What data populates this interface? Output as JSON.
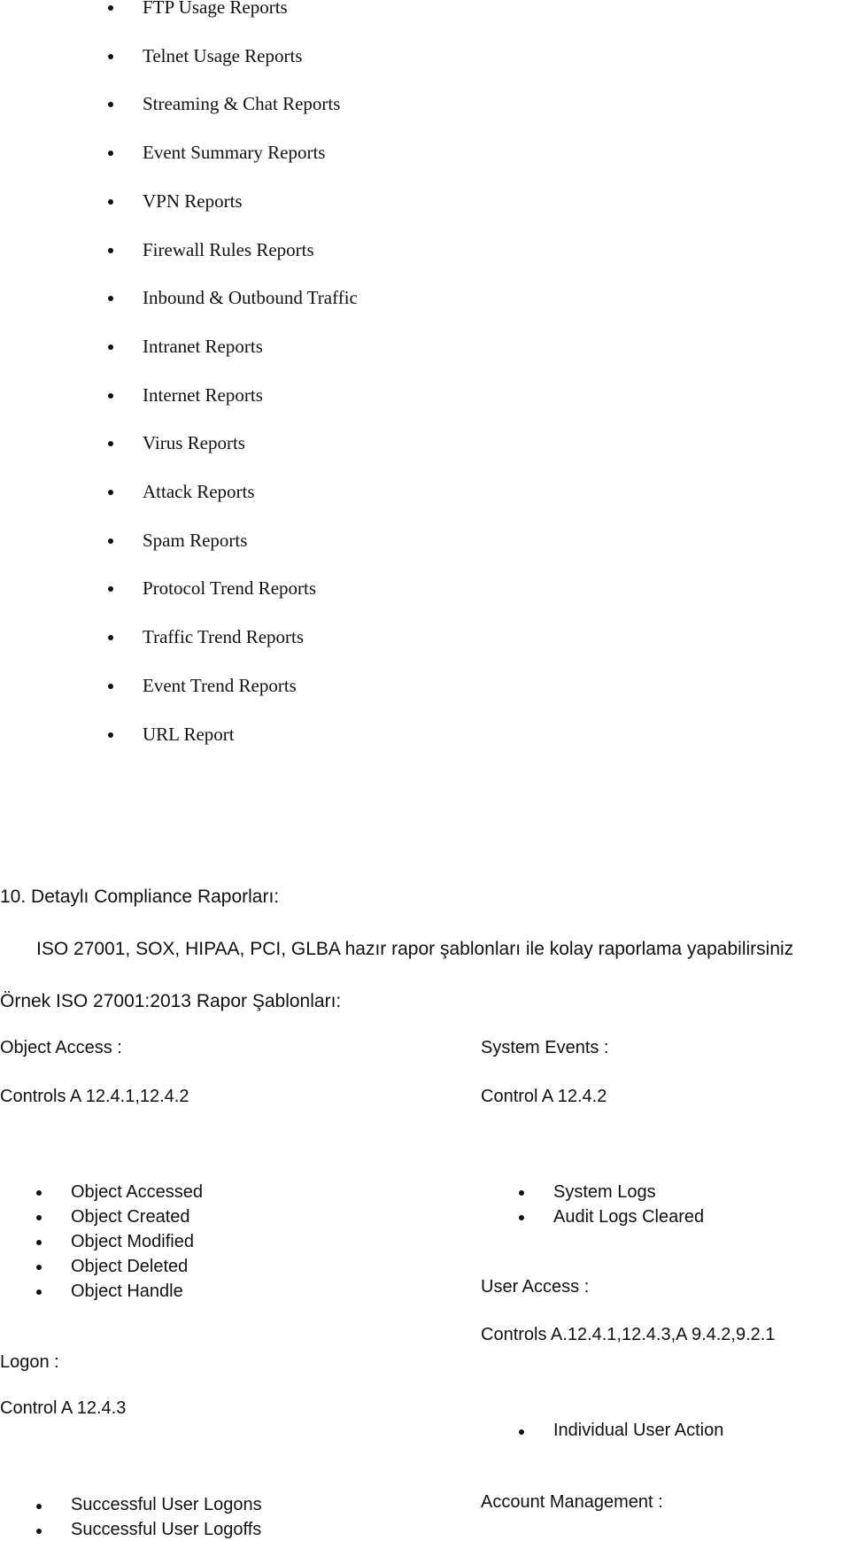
{
  "report_list": [
    "FTP Usage Reports",
    "Telnet Usage Reports",
    "Streaming & Chat Reports",
    "Event Summary Reports",
    "VPN Reports",
    "Firewall Rules Reports",
    "Inbound & Outbound Traffic",
    "Intranet Reports",
    "Internet Reports",
    "Virus Reports",
    "Attack Reports",
    "Spam Reports",
    "Protocol Trend Reports",
    "Traffic Trend Reports",
    "Event Trend Reports",
    "URL Report"
  ],
  "section": {
    "heading": "10. Detaylı Compliance Raporları:",
    "intro": "ISO 27001, SOX, HIPAA, PCI, GLBA hazır rapor şablonları ile kolay raporlama yapabilirsiniz",
    "subheading": "Örnek ISO 27001:2013 Rapor Şablonları:"
  },
  "object_access": {
    "title": "Object Access :",
    "controls": "Controls A 12.4.1,12.4.2",
    "items": [
      "Object Accessed",
      "Object Created",
      "Object Modified",
      "Object Deleted",
      "Object Handle"
    ]
  },
  "system_events": {
    "title": "System Events :",
    "controls": "Control A 12.4.2",
    "items": [
      "System Logs",
      "Audit Logs Cleared"
    ]
  },
  "user_access": {
    "title": "User Access :",
    "controls": "Controls A.12.4.1,12.4.3,A 9.4.2,9.2.1",
    "items": [
      "Individual User Action"
    ]
  },
  "logon": {
    "title": "Logon :",
    "controls": "Control A 12.4.3",
    "items": [
      "Successful User Logons",
      "Successful User Logoffs"
    ]
  },
  "account_management": {
    "title": "Account Management :"
  }
}
